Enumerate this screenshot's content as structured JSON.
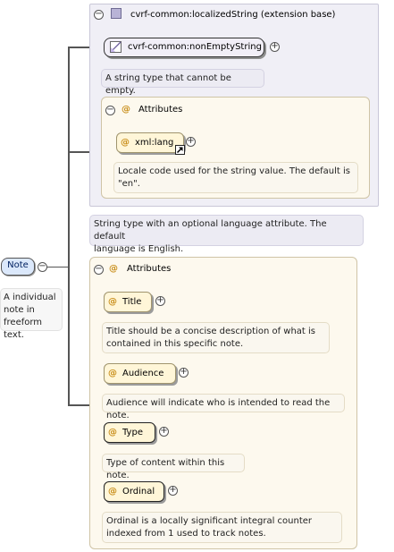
{
  "root": {
    "name": "Note",
    "doc": [
      "A individual",
      "note in",
      "freeform text."
    ]
  },
  "extension": {
    "header": "cvrf-common:localizedString (extension base)",
    "base_type": "cvrf-common:nonEmptyString",
    "base_doc": "A string type that cannot be empty.",
    "attributes_label": "Attributes",
    "lang_attr": {
      "name": "xml:lang",
      "doc": [
        "Locale code used for the string value. The default is",
        "\"en\"."
      ]
    },
    "doc": [
      "String type with an optional language attribute. The default",
      "language is English."
    ]
  },
  "attributes": {
    "label": "Attributes",
    "items": [
      {
        "name": "Title",
        "doc": [
          "Title should be a concise description of what is",
          "contained in this specific note."
        ]
      },
      {
        "name": "Audience",
        "doc": [
          "Audience will indicate who is intended to read the note."
        ]
      },
      {
        "name": "Type",
        "doc": [
          "Type of content within this note."
        ]
      },
      {
        "name": "Ordinal",
        "doc": [
          "Ordinal is a locally significant integral counter",
          "indexed from 1 used to track notes."
        ]
      }
    ]
  },
  "icons": {
    "collapse": "minus-circle-icon",
    "expand": "plus-circle-icon",
    "complex_type": "complex-type-square-icon",
    "simple_type": "simple-type-icon",
    "attribute": "at-sign-icon",
    "shortcut": "shortcut-arrow-icon"
  },
  "colors": {
    "extension_background": "#f0eff6",
    "attributes_background": "#fdf9ee",
    "attribute_node": "#fff6d8",
    "root_node": "#dbe8fb",
    "attribute_symbol": "#c98f1b"
  },
  "symbols": {
    "collapse": "−",
    "expand": "+",
    "at": "@"
  }
}
